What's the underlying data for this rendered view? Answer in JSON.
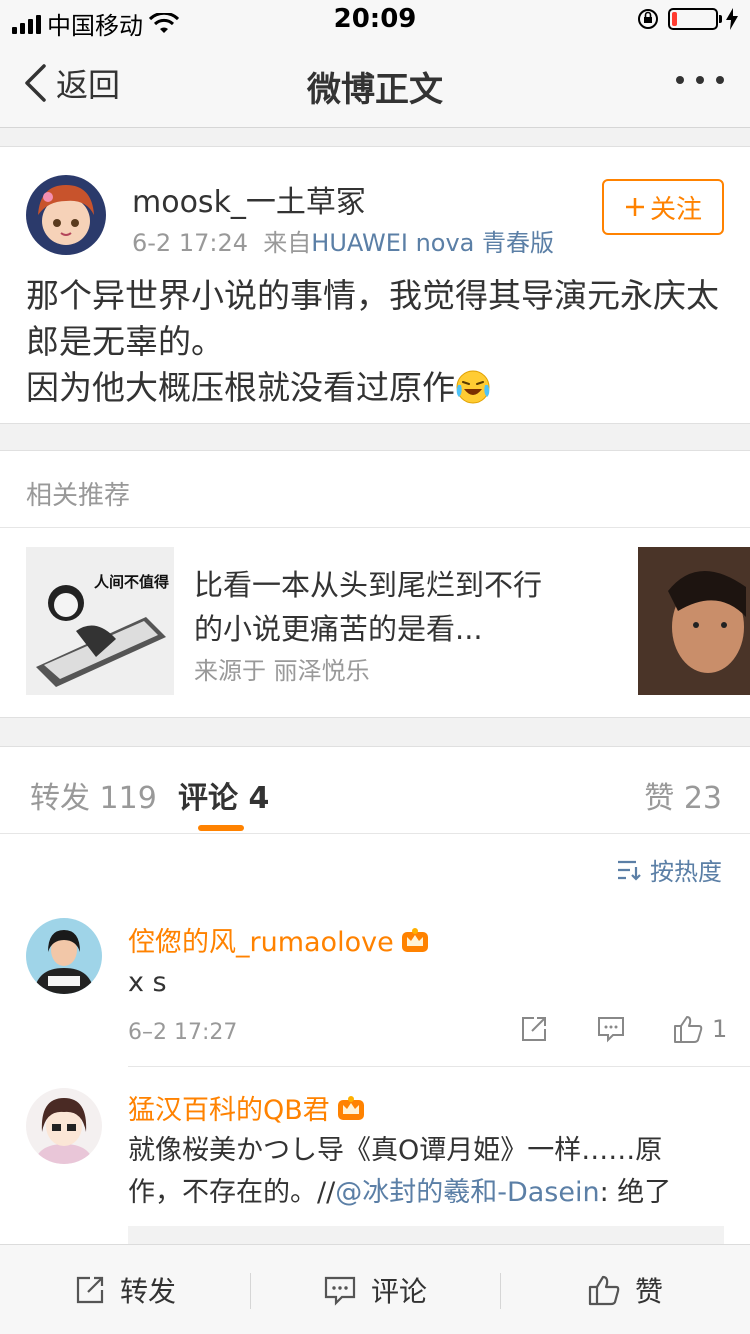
{
  "status_bar": {
    "carrier": "中国移动",
    "time": "20:09",
    "battery_level": 0.12
  },
  "nav": {
    "back_label": "返回",
    "title": "微博正文"
  },
  "post": {
    "username": "moosk_一土草冢",
    "time": "6-2 17:24",
    "source_prefix": "来自",
    "source": "HUAWEI nova 青春版",
    "follow_label": "关注",
    "text_line1": "那个异世界小说的事情，我觉得其导演元永庆太郎是无辜的。",
    "text_line2": "因为他大概压根就没看过原作"
  },
  "recommend": {
    "header": "相关推荐",
    "thumb_caption": "人间不值得",
    "title": "比看一本从头到尾烂到不行的小说更痛苦的是看...",
    "source_prefix": "来源于",
    "source_name": "丽泽悦乐"
  },
  "tabs": {
    "repost_label": "转发",
    "repost_count": "119",
    "comment_label": "评论",
    "comment_count": "4",
    "like_label": "赞",
    "like_count": "23"
  },
  "comments": {
    "sort_label": "按热度",
    "items": [
      {
        "name": "倥偬的风_rumaolove",
        "text": "x s",
        "time": "6–2 17:27",
        "likes": "1"
      },
      {
        "name": "猛汉百科的QB君",
        "text_line1": "就像桜美かつし导《真O谭月姫》一样……原",
        "text_line2_prefix": "作，不存在的。//",
        "mention": "@冰封的羲和-Dasein",
        "text_line2_suffix": ": 绝了"
      }
    ]
  },
  "bottom_bar": {
    "repost_label": "转发",
    "comment_label": "评论",
    "like_label": "赞"
  },
  "colors": {
    "accent": "#ff8200",
    "link": "#5b7fa6",
    "text": "#333333",
    "muted": "#999999"
  }
}
